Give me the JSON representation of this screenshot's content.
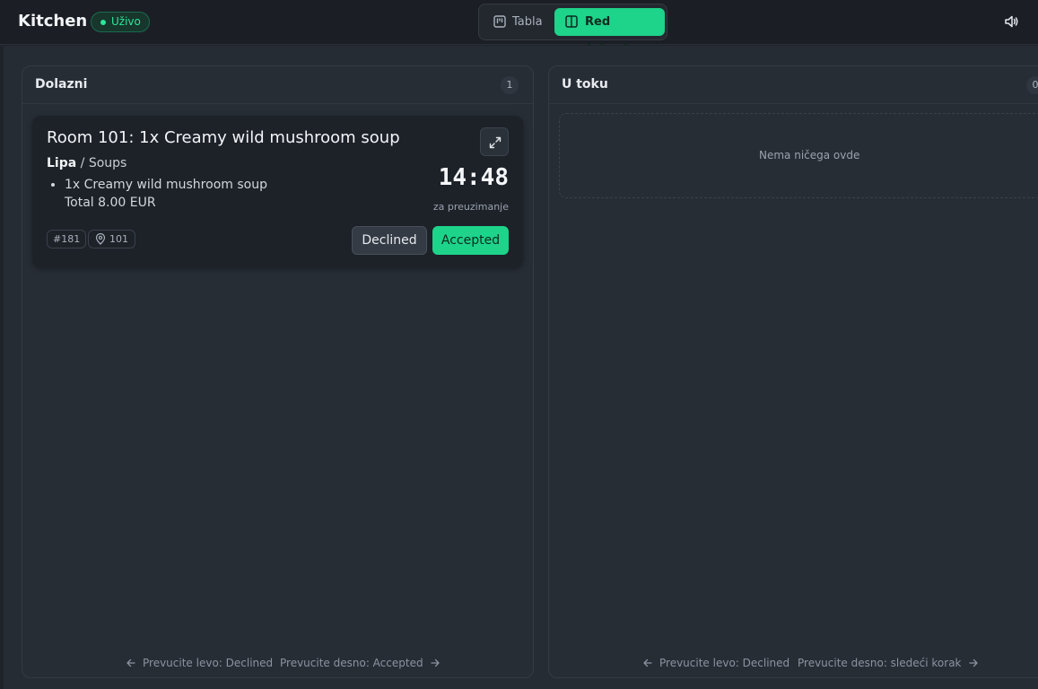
{
  "header": {
    "title": "Kitchen",
    "live_label": "Uživo",
    "tabs": [
      {
        "label": "Tabla",
        "active": false
      },
      {
        "label": "Red čekanja",
        "active": true
      }
    ]
  },
  "colors": {
    "accent": "#1ed38a",
    "live": "#2ee59a",
    "background": "#262c34",
    "card": "#1d2229"
  },
  "columns": {
    "incoming": {
      "title": "Dolazni",
      "count": "1",
      "hint_left": "Prevucite levo: Declined",
      "hint_right": "Prevucite desno: Accepted"
    },
    "in_progress": {
      "title": "U toku",
      "count": "0",
      "empty_text": "Nema ničega ovde",
      "hint_left": "Prevucite levo: Declined",
      "hint_right": "Prevucite desno: sledeći korak"
    }
  },
  "order": {
    "title": "Room 101: 1x Creamy wild mushroom soup",
    "location": "Lipa",
    "separator": " / ",
    "category": "Soups",
    "items": [
      "1x Creamy wild mushroom soup"
    ],
    "total": "Total 8.00 EUR",
    "timer": "14:48",
    "timer_caption": "za preuzimanje",
    "order_number": "#181",
    "room": "101",
    "decline_label": "Declined",
    "accept_label": "Accepted"
  },
  "icons": {
    "tab_table": "kanban-icon",
    "tab_queue": "columns-icon",
    "sound": "speaker-icon",
    "expand": "expand-icon",
    "room": "map-pin-icon",
    "arrow_left": "arrow-left-icon",
    "arrow_right": "arrow-right-icon"
  }
}
